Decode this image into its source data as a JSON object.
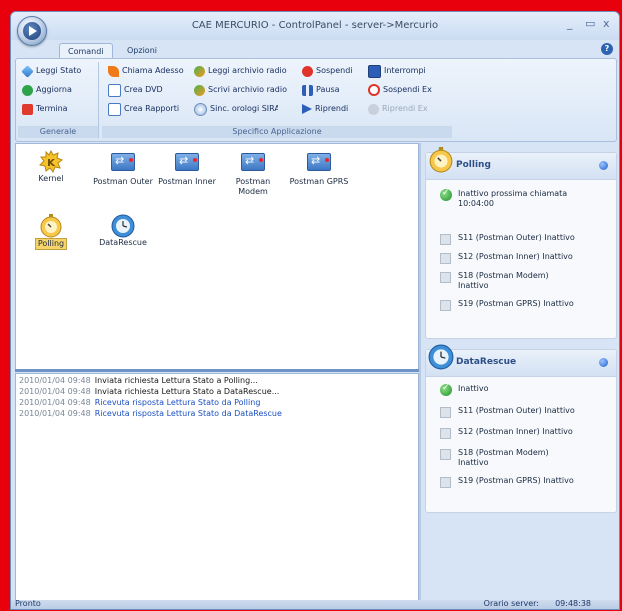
{
  "window": {
    "title": "CAE MERCURIO   -  ControlPanel - server->Mercurio",
    "minimize": "_",
    "maximize": "▭",
    "close": "x"
  },
  "tabs": {
    "comandi": "Comandi",
    "opzioni": "Opzioni",
    "help": "?"
  },
  "ribbon": {
    "generale": {
      "label": "Generale",
      "leggi_stato": "Leggi Stato",
      "aggiorna": "Aggiorna",
      "termina": "Termina"
    },
    "specifico": {
      "label": "Specifico Applicazione",
      "chiama_adesso": "Chiama Adesso",
      "crea_dvd": "Crea DVD",
      "crea_rapporti": "Crea Rapporti",
      "leggi_archivio_radio": "Leggi archivio radio",
      "scrivi_archivio_radio": "Scrivi archivio radio",
      "sinc_orologi": "Sinc. orologi SIRA",
      "sospendi": "Sospendi",
      "pausa": "Pausa",
      "riprendi": "Riprendi",
      "interrompi": "Interrompi",
      "sospendi_ex": "Sospendi Ex",
      "riprendi_ex": "Riprendi Ex"
    }
  },
  "icons": {
    "kernel": "Kernel",
    "postman_outer": "Postman Outer",
    "postman_inner": "Postman Inner",
    "postman_modem": "Postman Modem",
    "postman_gprs": "Postman GPRS",
    "polling": "Polling",
    "datarescue": "DataRescue"
  },
  "log": [
    {
      "time": "2010/01/04 09:48",
      "msg": "Inviata richiesta Lettura Stato a Polling..."
    },
    {
      "time": "2010/01/04 09:48",
      "msg": "Inviata richiesta Lettura Stato a DataRescue..."
    },
    {
      "time": "2010/01/04 09:48",
      "msg": "Ricevuta risposta Lettura Stato da Polling"
    },
    {
      "time": "2010/01/04 09:48",
      "msg": "Ricevuta risposta Lettura Stato da DataRescue"
    }
  ],
  "polling_panel": {
    "title": "Polling",
    "status": "Inattivo    prossima chiamata 10:04:00",
    "items": [
      "S11 (Postman Outer)  Inattivo",
      "S12 (Postman Inner)  Inattivo",
      "S18 (Postman Modem) Inattivo",
      "S19 (Postman GPRS)  Inattivo"
    ]
  },
  "datarescue_panel": {
    "title": "DataRescue",
    "status": "Inattivo",
    "items": [
      "S11 (Postman Outer)  Inattivo",
      "S12 (Postman Inner)  Inattivo",
      "S18 (Postman Modem) Inattivo",
      "S19 (Postman GPRS)  Inattivo"
    ]
  },
  "status_bar": {
    "left": "Pronto",
    "server_label": "Orario server:",
    "server_time": "09:48:38"
  }
}
